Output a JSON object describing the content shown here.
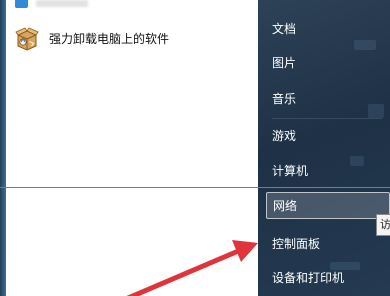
{
  "program_list": {
    "items": [
      {
        "label": "强力卸载电脑上的软件",
        "icon": "uninstall-box-icon"
      }
    ]
  },
  "nav": {
    "items": [
      {
        "label": "文档"
      },
      {
        "label": "图片"
      },
      {
        "label": "音乐"
      },
      {
        "label": "游戏"
      },
      {
        "label": "计算机"
      },
      {
        "label": "网络",
        "highlighted": true
      },
      {
        "label": "控制面板"
      },
      {
        "label": "设备和打印机"
      }
    ]
  },
  "tooltip": {
    "text": "访"
  },
  "colors": {
    "panel_dark": "#1e3146",
    "annotation_red": "#e0343c",
    "highlight_border": "#ffffff"
  }
}
